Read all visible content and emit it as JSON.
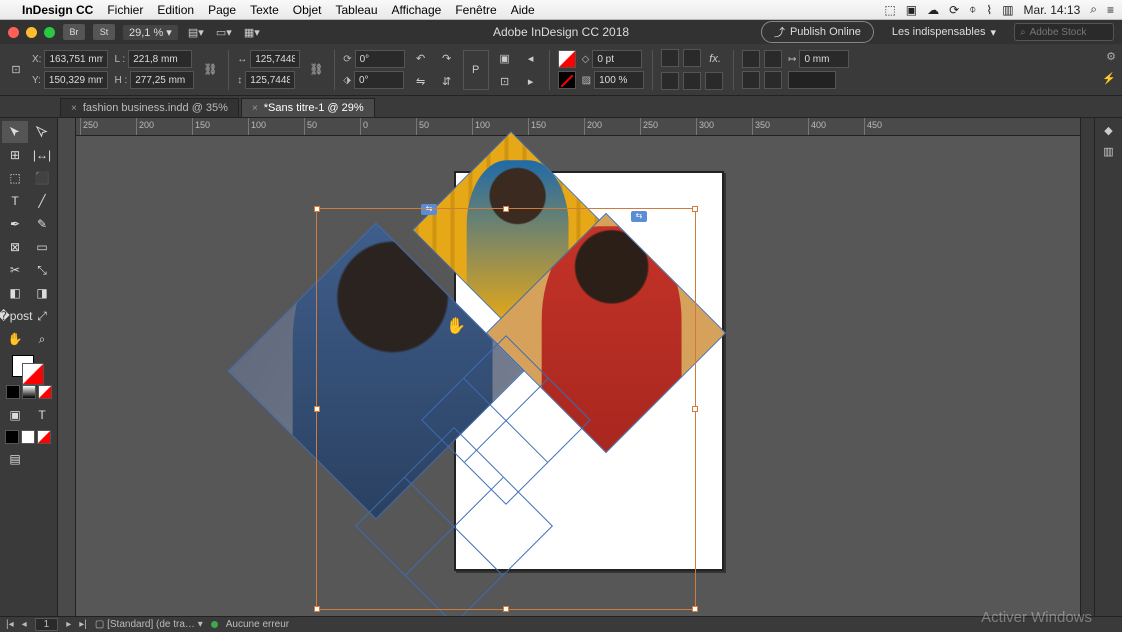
{
  "mac": {
    "app": "InDesign CC",
    "menus": [
      "Fichier",
      "Edition",
      "Page",
      "Texte",
      "Objet",
      "Tableau",
      "Affichage",
      "Fenêtre",
      "Aide"
    ],
    "clock": "Mar. 14:13"
  },
  "win": {
    "chips": [
      "Br",
      "St"
    ],
    "zoom": "29,1 %",
    "title": "Adobe InDesign CC 2018",
    "publish": "Publish Online",
    "workspace": "Les indispensables",
    "stock_placeholder": "Adobe Stock"
  },
  "ctrl": {
    "x_label": "X:",
    "x": "163,751 mm",
    "y_label": "Y:",
    "y": "150,329 mm",
    "w_label": "L :",
    "w": "221,8 mm",
    "h_label": "H :",
    "h": "277,25 mm",
    "sx": "125,7448 ▸",
    "sy": "125,7448 ▸",
    "rot_label": "⟳",
    "rot": "0°",
    "shear_label": "⬗",
    "shear": "0°",
    "stroke_label": "◇",
    "stroke": "0 pt",
    "fx": "fx.",
    "opacity": "100 %",
    "gap": "0 mm"
  },
  "tabs": [
    {
      "label": "fashion business.indd @ 35%",
      "active": false
    },
    {
      "label": "*Sans titre-1 @ 29%",
      "active": true
    }
  ],
  "ruler": [
    "250",
    "200",
    "150",
    "100",
    "50",
    "0",
    "50",
    "100",
    "150",
    "200",
    "250",
    "300",
    "350",
    "400",
    "450"
  ],
  "status": {
    "page": "1",
    "preset": "[Standard] (de tra…",
    "errors": "Aucune erreur"
  },
  "watermark": "Activer Windows"
}
